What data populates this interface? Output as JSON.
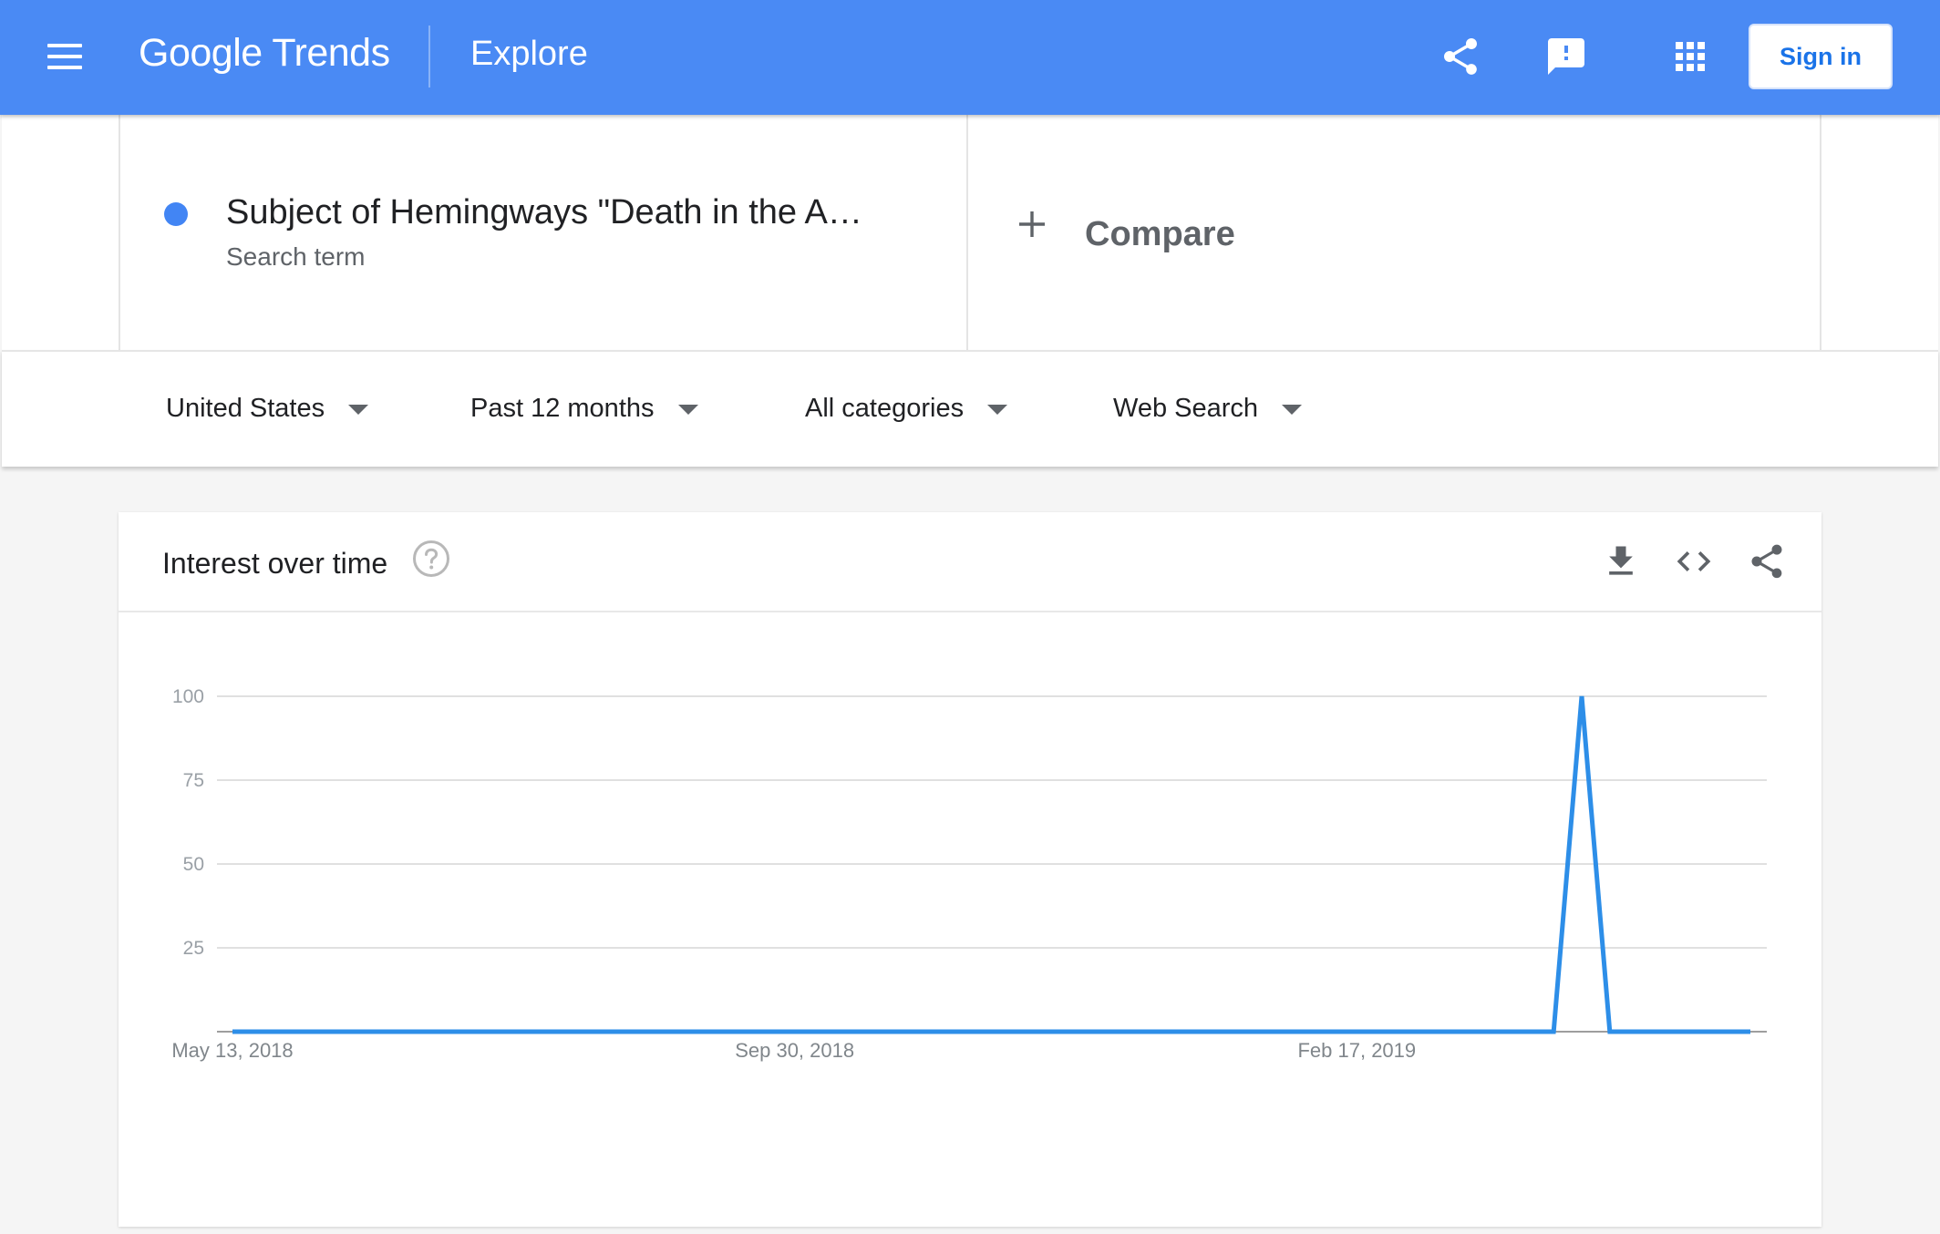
{
  "header": {
    "brand_google": "Google",
    "brand_trends": "Trends",
    "section": "Explore",
    "sign_in": "Sign in",
    "accent_color": "#4a8af4",
    "icons": [
      "menu-icon",
      "share-icon",
      "feedback-icon",
      "apps-icon"
    ]
  },
  "search_term": {
    "title": "Subject of Hemingways \"Death in the A…",
    "subtitle": "Search term",
    "dot_color": "#4285f4"
  },
  "compare": {
    "label": "Compare",
    "icon": "plus-icon"
  },
  "filters": {
    "region": "United States",
    "time": "Past 12 months",
    "category": "All categories",
    "search_type": "Web Search"
  },
  "card": {
    "title": "Interest over time",
    "icons": [
      "help-icon",
      "download-icon",
      "embed-code-icon",
      "share-icon"
    ]
  },
  "chart_data": {
    "type": "line",
    "x_tick_labels": [
      "May 13, 2018",
      "Sep 30, 2018",
      "Feb 17, 2019"
    ],
    "y_ticks": [
      25,
      50,
      75,
      100
    ],
    "ylim": [
      0,
      100
    ],
    "grid": true,
    "line_color": "#2d8ee8",
    "series": [
      {
        "values": [
          0,
          0,
          0,
          0,
          0,
          0,
          0,
          0,
          0,
          0,
          0,
          0,
          0,
          0,
          0,
          0,
          0,
          0,
          0,
          0,
          0,
          0,
          0,
          0,
          0,
          0,
          0,
          0,
          0,
          0,
          0,
          0,
          0,
          0,
          0,
          0,
          0,
          0,
          0,
          0,
          0,
          0,
          0,
          0,
          0,
          0,
          0,
          0,
          100,
          0,
          0,
          0,
          0,
          0,
          0
        ]
      }
    ]
  }
}
